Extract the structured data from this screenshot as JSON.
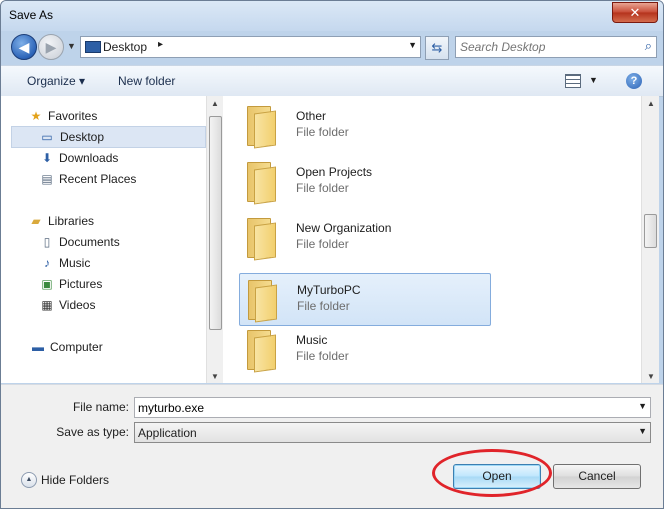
{
  "window": {
    "title": "Save As",
    "close_glyph": "✕"
  },
  "address": {
    "location": "Desktop",
    "separator": "▸"
  },
  "search": {
    "placeholder": "Search Desktop"
  },
  "toolbar": {
    "organize": "Organize ▾",
    "new_folder": "New folder",
    "help": "?"
  },
  "nav": {
    "items": [
      {
        "label": "Favorites",
        "icon": "star-icon",
        "glyph": "★",
        "color": "#e3a21a"
      },
      {
        "label": "Desktop",
        "icon": "desktop-icon",
        "glyph": "▭",
        "color": "#2d5fa5",
        "selected": true
      },
      {
        "label": "Downloads",
        "icon": "downloads-icon",
        "glyph": "⬇",
        "color": "#2d5fa5"
      },
      {
        "label": "Recent Places",
        "icon": "recent-places-icon",
        "glyph": "▤",
        "color": "#5a6b80"
      },
      {
        "label": "Libraries",
        "icon": "libraries-icon",
        "glyph": "▰",
        "color": "#d9a93c"
      },
      {
        "label": "Documents",
        "icon": "documents-icon",
        "glyph": "▯",
        "color": "#5a6b80"
      },
      {
        "label": "Music",
        "icon": "music-icon",
        "glyph": "♪",
        "color": "#2d5fa5"
      },
      {
        "label": "Pictures",
        "icon": "pictures-icon",
        "glyph": "▣",
        "color": "#3b8a3e"
      },
      {
        "label": "Videos",
        "icon": "videos-icon",
        "glyph": "▦",
        "color": "#3a3a3a"
      },
      {
        "label": "Computer",
        "icon": "computer-icon",
        "glyph": "▬",
        "color": "#2d5fa5"
      }
    ]
  },
  "files": {
    "items": [
      {
        "name": "Other",
        "type": "File folder"
      },
      {
        "name": "Open Projects",
        "type": "File folder"
      },
      {
        "name": "New Organization",
        "type": "File folder"
      },
      {
        "name": "MyTurboPC",
        "type": "File folder",
        "selected": true
      },
      {
        "name": "Music",
        "type": "File folder"
      }
    ]
  },
  "form": {
    "file_name_label": "File name:",
    "file_name_value": "myturbo.exe",
    "save_type_label": "Save as type:",
    "save_type_value": "Application"
  },
  "buttons": {
    "hide_folders": "Hide Folders",
    "open": "Open",
    "cancel": "Cancel"
  },
  "colors": {
    "accent": "#2d5fa5",
    "selection": "#d2e4f7",
    "annotation": "#e0242a"
  }
}
